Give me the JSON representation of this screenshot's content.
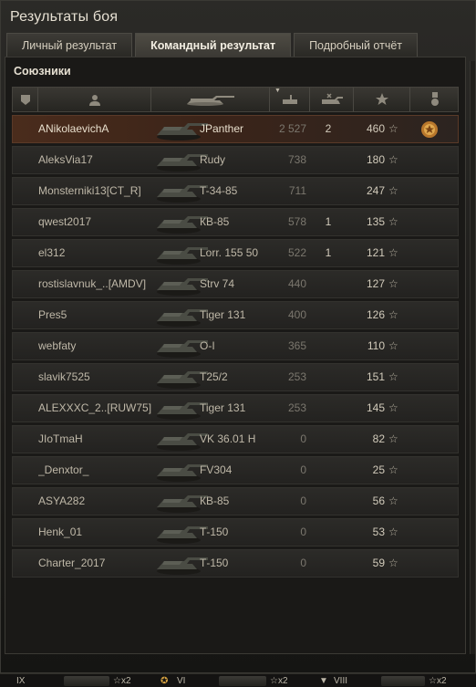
{
  "window": {
    "title": "Результаты боя"
  },
  "tabs": [
    {
      "label": "Личный результат",
      "active": false
    },
    {
      "label": "Командный результат",
      "active": true
    },
    {
      "label": "Подробный отчёт",
      "active": false
    }
  ],
  "section_title": "Союзники",
  "columns": [
    {
      "name": "squad",
      "icon": "squad-icon"
    },
    {
      "name": "player",
      "icon": "player-icon"
    },
    {
      "name": "tank",
      "icon": "tank-icon"
    },
    {
      "name": "damage",
      "icon": "damage-icon",
      "sorted": true
    },
    {
      "name": "kills",
      "icon": "destroyed-tank-icon"
    },
    {
      "name": "xp",
      "icon": "star-icon"
    },
    {
      "name": "medals",
      "icon": "medal-icon"
    }
  ],
  "rows": [
    {
      "player": "ANikolaevichA",
      "tank": "JPanther",
      "damage": "2 527",
      "kills": "2",
      "xp": "460",
      "self": true,
      "medal": true
    },
    {
      "player": "AleksVia17",
      "tank": "Rudy",
      "damage": "738",
      "kills": "",
      "xp": "180"
    },
    {
      "player": "Monsterniki13[CT_R]",
      "tank": "T-34-85",
      "damage": "711",
      "kills": "",
      "xp": "247"
    },
    {
      "player": "qwest2017",
      "tank": "КВ-85",
      "damage": "578",
      "kills": "1",
      "xp": "135"
    },
    {
      "player": "el312",
      "tank": "Lorr. 155 50",
      "damage": "522",
      "kills": "1",
      "xp": "121"
    },
    {
      "player": "rostislavnuk_..[AMDV]",
      "tank": "Strv 74",
      "damage": "440",
      "kills": "",
      "xp": "127"
    },
    {
      "player": "Pres5",
      "tank": "Tiger 131",
      "damage": "400",
      "kills": "",
      "xp": "126"
    },
    {
      "player": "webfaty",
      "tank": "O-I",
      "damage": "365",
      "kills": "",
      "xp": "110"
    },
    {
      "player": "slavik7525",
      "tank": "T25/2",
      "damage": "253",
      "kills": "",
      "xp": "151"
    },
    {
      "player": "ALEXXXC_2..[RUW75]",
      "tank": "Tiger 131",
      "damage": "253",
      "kills": "",
      "xp": "145"
    },
    {
      "player": "JIoTmaH",
      "tank": "VK 36.01 H",
      "damage": "0",
      "kills": "",
      "xp": "82"
    },
    {
      "player": "_Denxtor_",
      "tank": "FV304",
      "damage": "0",
      "kills": "",
      "xp": "25"
    },
    {
      "player": "ASYA282",
      "tank": "КВ-85",
      "damage": "0",
      "kills": "",
      "xp": "56"
    },
    {
      "player": "Henk_01",
      "tank": "Т-150",
      "damage": "0",
      "kills": "",
      "xp": "53"
    },
    {
      "player": "Charter_2017",
      "tank": "Т-150",
      "damage": "0",
      "kills": "",
      "xp": "59"
    }
  ],
  "xp_symbol": "☆",
  "footer": [
    {
      "tier": "IX",
      "mult": "☆x2"
    },
    {
      "tier": "VI",
      "mult": "☆x2"
    },
    {
      "tier": "VIII",
      "mult": "☆x2"
    }
  ],
  "colors": {
    "self_row": "#4a2c1c",
    "row_bg": "#2c2b28",
    "text": "#bfb8a8"
  }
}
